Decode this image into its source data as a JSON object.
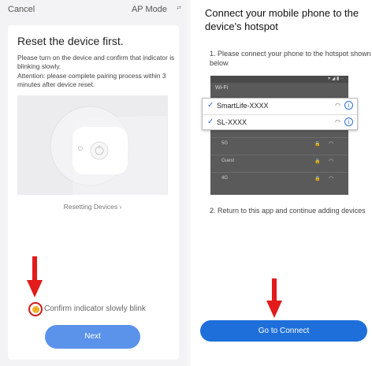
{
  "left_screen": {
    "cancel_label": "Cancel",
    "mode_label": "AP Mode",
    "mode_icon": "swap-icon",
    "title": "Reset the device first.",
    "description": "Please turn on the device and confirm that indicator is blinking slowly.",
    "attention": "Attention: please complete pairing process within 3 minutes after device reset.",
    "illustration_icon": "device-power-illustration",
    "resetting_link": "Resetting Devices",
    "confirm_label": "Confirm indicator slowly blink",
    "confirm_checked": true,
    "next_label": "Next",
    "colors": {
      "accent": "#5b92ea",
      "check": "#f0b12a",
      "highlight_ring": "#d11a1a",
      "arrow": "#e21b1b"
    }
  },
  "right_screen": {
    "title": "Connect your mobile phone to the device's hotspot",
    "step1": "1. Please connect your phone to the hotspot shown below",
    "wifi_header": "Wi-Fi",
    "networks": [
      "5G",
      "Guest",
      "4G"
    ],
    "highlighted_networks": [
      {
        "name": "SmartLife-XXXX"
      },
      {
        "name": "SL-XXXX"
      }
    ],
    "step2": "2. Return to this app and continue adding devices",
    "connect_label": "Go to Connect",
    "colors": {
      "accent": "#1e6fd9"
    }
  }
}
